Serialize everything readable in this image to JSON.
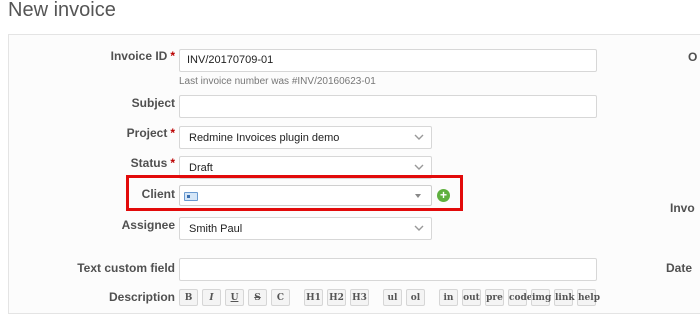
{
  "page": {
    "title": "New invoice"
  },
  "form": {
    "invoice_id": {
      "label": "Invoice ID",
      "required_mark": "*",
      "value": "INV/20170709-01",
      "hint": "Last invoice number was #INV/20160623-01"
    },
    "subject": {
      "label": "Subject",
      "value": ""
    },
    "project": {
      "label": "Project",
      "required_mark": "*",
      "value": "Redmine Invoices plugin demo"
    },
    "status": {
      "label": "Status",
      "required_mark": "*",
      "value": "Draft"
    },
    "client": {
      "label": "Client",
      "value": "",
      "add_icon": "plus-circle-icon"
    },
    "assignee": {
      "label": "Assignee",
      "value": "Smith Paul"
    },
    "text_custom_field": {
      "label": "Text custom field",
      "value": ""
    },
    "description": {
      "label": "Description"
    }
  },
  "right_column": {
    "label_top": "O",
    "label_mid": "Invo",
    "label_bottom": "Date"
  },
  "toolbar": {
    "buttons": [
      "B",
      "I",
      "U",
      "S",
      "C",
      "H1",
      "H2",
      "H3",
      "ul",
      "ol",
      "in",
      "out",
      "pre",
      "code",
      "img",
      "link",
      "help"
    ]
  },
  "colors": {
    "highlight": "#e20a0a",
    "required": "#bb0000",
    "add_button": "#5fb03f"
  }
}
